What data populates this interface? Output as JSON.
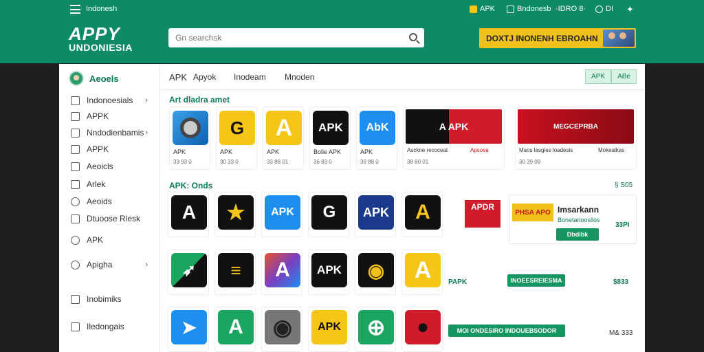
{
  "header": {
    "site_name": "Indonesh",
    "top_items": [
      "APK",
      "Bndonesb",
      "·IDRO 8·",
      "DI"
    ],
    "logo_line1": "APPY",
    "logo_line2": "UNDONIESIA",
    "search_placeholder": "Gn searchsk",
    "promo_text": "DOXTJ INONENH EBROAHN",
    "colors": {
      "brand": "#0f8a66",
      "promo": "#f2c01a"
    }
  },
  "sidebar": {
    "head": "Aeoels",
    "items": [
      {
        "label": "Indonoesials",
        "chev": "›"
      },
      {
        "label": "APPK",
        "chev": ""
      },
      {
        "label": "Nndodienbamis",
        "chev": "›"
      },
      {
        "label": "APPK",
        "chev": ""
      },
      {
        "label": "Aeoicls",
        "chev": ""
      },
      {
        "label": "Arlek",
        "chev": ""
      },
      {
        "label": "Aeoids",
        "chev": ""
      },
      {
        "label": "Dtuoose Rlesk",
        "chev": ""
      },
      {
        "label": "APK",
        "chev": ""
      },
      {
        "label": "Apigha",
        "chev": "›"
      },
      {
        "label": "Inobimiks",
        "chev": ""
      },
      {
        "label": "Iledongais",
        "chev": ""
      }
    ]
  },
  "tabs": {
    "items": [
      "APK",
      "Apyok",
      "Inodeam",
      "Mnoden"
    ],
    "buttons": [
      "APK",
      "ABe"
    ]
  },
  "section1": {
    "title": "Art dladra amet",
    "cards": [
      {
        "icon": "camera-icon",
        "text": "",
        "name": "APK",
        "size": "33 93 0"
      },
      {
        "icon": "g-icon",
        "text": "G",
        "name": "APK",
        "size": "30 33 0"
      },
      {
        "icon": "a-icon",
        "text": "A",
        "name": "APK",
        "size": "33 88 01"
      },
      {
        "icon": "apk-icon",
        "text": "APK",
        "name": "Bolie APK",
        "size": "36 83 0"
      },
      {
        "icon": "abk-icon",
        "text": "AbK",
        "name": "APK",
        "size": "39 88 0"
      }
    ],
    "banners": [
      {
        "art": "A APK",
        "name": "Asckne recoceat",
        "tag": "Apsosa",
        "size": "38 80 01"
      },
      {
        "art": "MEGCEPRBA",
        "name": "Maos lasgies loadesis",
        "tag": "Mokealkas",
        "size": "30 39 09"
      }
    ]
  },
  "section2": {
    "title": "APK: Onds",
    "aux": "§ S05",
    "tiles": [
      {
        "icon": "a-icon",
        "text": "A"
      },
      {
        "icon": "star-icon",
        "text": "★"
      },
      {
        "icon": "apk-icon",
        "text": "APK"
      },
      {
        "icon": "g-icon",
        "text": "G"
      },
      {
        "icon": "apk-icon",
        "text": "APK"
      },
      {
        "icon": "a-icon",
        "text": "A"
      }
    ],
    "ad": {
      "badge": "APDR",
      "logo": "PHSA APO",
      "title": "Imsarkann",
      "sub": "Bonetarioosllos",
      "price": "33PI",
      "button": "Dbdibk"
    }
  },
  "row3": {
    "tiles": [
      {
        "icon": "arrow-icon",
        "text": "➶"
      },
      {
        "icon": "list-icon",
        "text": "≡"
      },
      {
        "icon": "a-icon",
        "text": "A"
      },
      {
        "icon": "apk-icon",
        "text": "APK"
      },
      {
        "icon": "o-icon",
        "text": "◉"
      },
      {
        "icon": "a-icon",
        "text": "A"
      }
    ],
    "label": "PAPK",
    "button": "INOEESREIESMA",
    "price": "$833"
  },
  "row4": {
    "tiles": [
      {
        "icon": "arrow-icon",
        "text": "➤"
      },
      {
        "icon": "a-icon",
        "text": "A"
      },
      {
        "icon": "camera-icon",
        "text": "◉"
      },
      {
        "icon": "apk-icon",
        "text": "APK"
      },
      {
        "icon": "globe-icon",
        "text": "⊕"
      },
      {
        "icon": "record-icon",
        "text": "●"
      }
    ],
    "button": "MOI ONDESIRO INDOUEBSODOR",
    "price": "M& 333"
  }
}
